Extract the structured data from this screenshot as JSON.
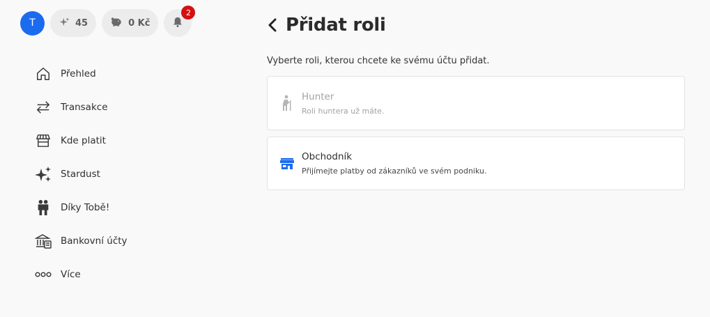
{
  "topbar": {
    "avatar_initial": "T",
    "stardust_count": "45",
    "balance": "0 Kč",
    "notification_count": "2"
  },
  "nav": {
    "items": [
      {
        "label": "Přehled",
        "icon": "home-icon"
      },
      {
        "label": "Transakce",
        "icon": "transfer-arrows-icon"
      },
      {
        "label": "Kde platit",
        "icon": "store-icon"
      },
      {
        "label": "Stardust",
        "icon": "sparkles-icon"
      },
      {
        "label": "Díky Tobě!",
        "icon": "people-icon"
      },
      {
        "label": "Bankovní účty",
        "icon": "bank-icon"
      },
      {
        "label": "Více",
        "icon": "more-dots-icon"
      }
    ]
  },
  "main": {
    "title": "Přidat roli",
    "subtitle": "Vyberte roli, kterou chcete ke svému účtu přidat.",
    "roles": [
      {
        "title": "Hunter",
        "description": "Roli huntera už máte.",
        "icon": "hiker-icon",
        "disabled": true
      },
      {
        "title": "Obchodník",
        "description": "Přijímejte platby od zákazníků ve svém podniku.",
        "icon": "storefront-icon",
        "disabled": false
      }
    ]
  },
  "colors": {
    "accent": "#1a6bf0",
    "badge": "#d41010",
    "background": "#f9f9f9"
  }
}
